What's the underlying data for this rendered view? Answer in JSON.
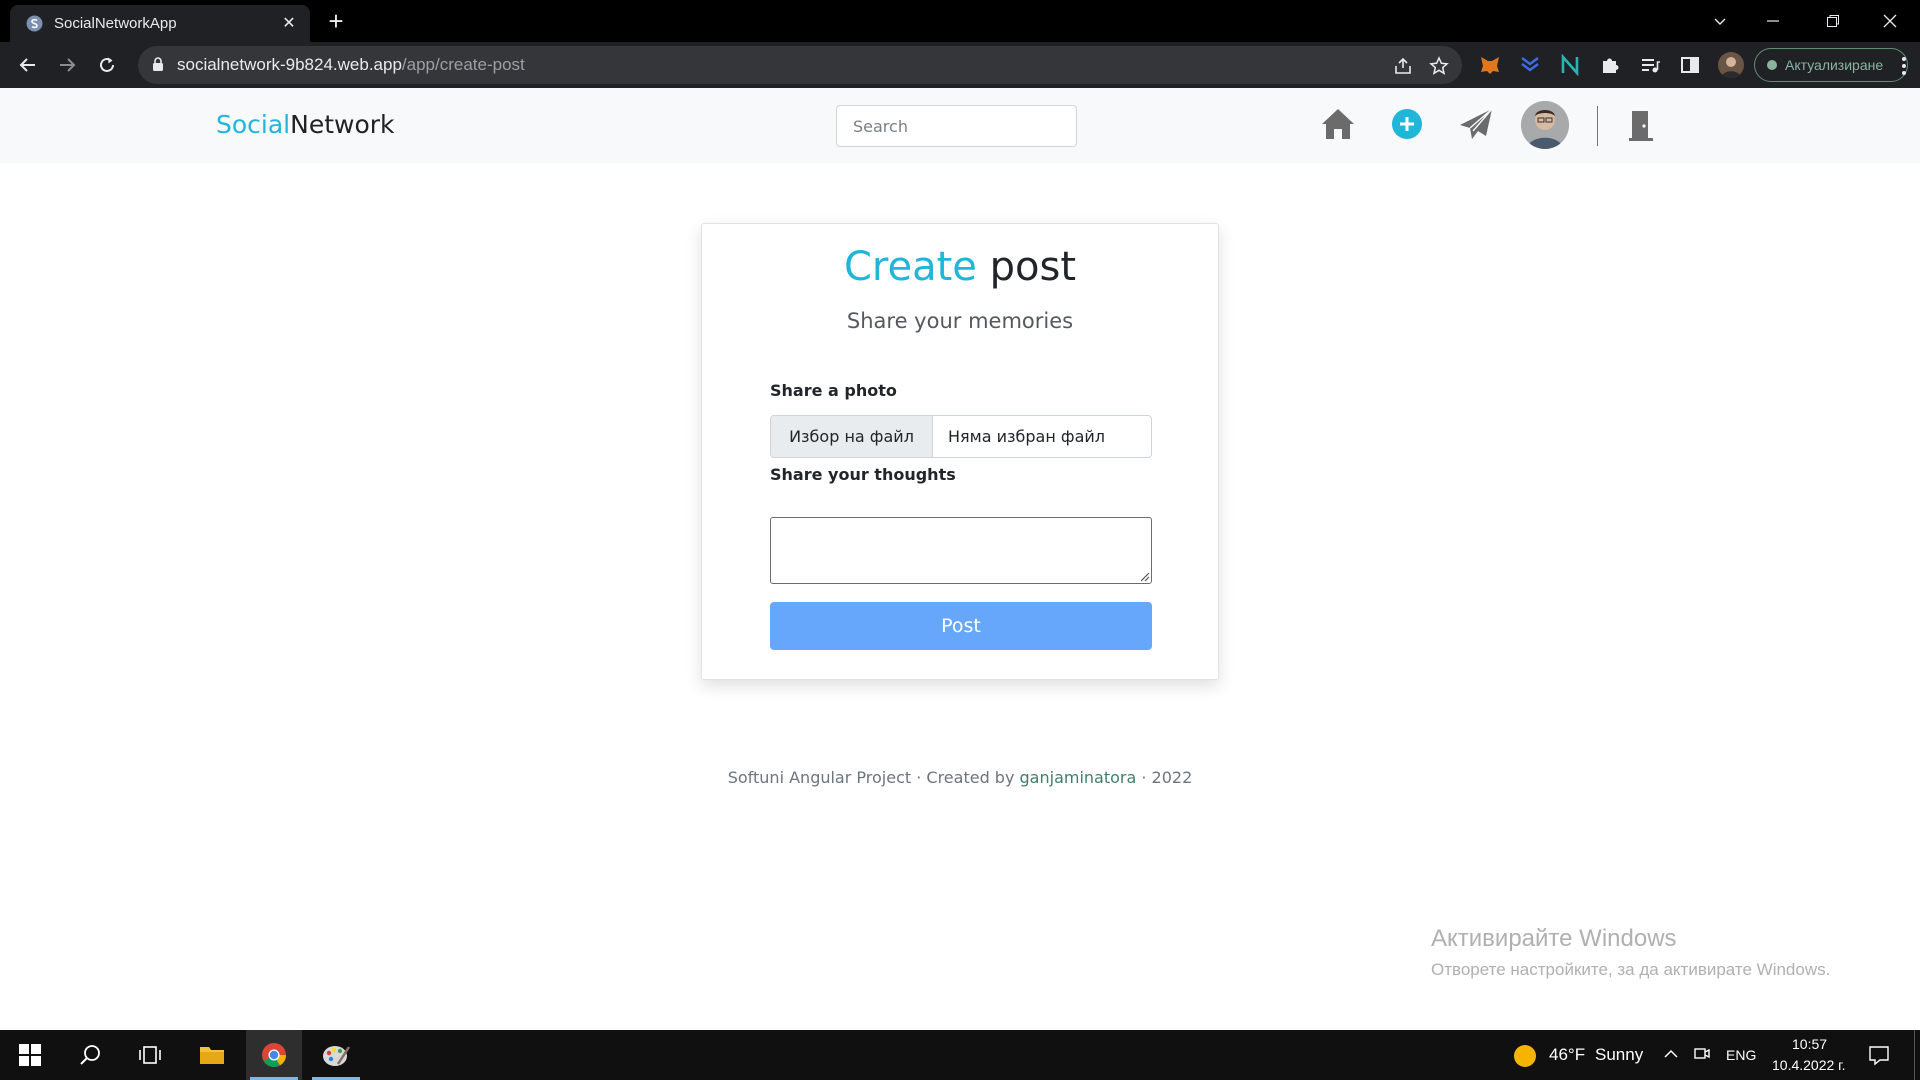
{
  "browser": {
    "tab_title": "SocialNetworkApp",
    "tab_close": "✕",
    "new_tab": "+",
    "url_host": "socialnetwork-9b824.web.app",
    "url_path": "/app/create-post",
    "update_button": "Актуализиране"
  },
  "header": {
    "brand_part1": "Social",
    "brand_part2": "Network",
    "search_placeholder": "Search",
    "accent_color": "#1fb6d9"
  },
  "card": {
    "title_part1": "Create",
    "title_part2": "post",
    "subtitle": "Share your memories",
    "photo_label": "Share a photo",
    "file_button": "Избор на файл",
    "file_status": "Няма избран файл",
    "thoughts_label": "Share your thoughts",
    "thoughts_value": "",
    "post_button": "Post",
    "post_button_color": "#66a7fb"
  },
  "footer": {
    "prefix": "Softuni Angular Project · Created by ",
    "author": "ganjaminatora",
    "suffix": " · 2022"
  },
  "watermark": {
    "line1": "Активирайте Windows",
    "line2": "Отворете настройките, за да активирате Windows."
  },
  "taskbar": {
    "weather_temp": "46°F",
    "weather_text": "Sunny",
    "language": "ENG",
    "time": "10:57",
    "date": "10.4.2022 г."
  }
}
